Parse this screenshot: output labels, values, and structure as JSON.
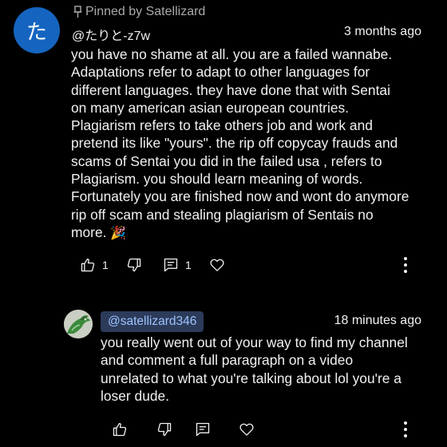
{
  "comment": {
    "avatar_letter": "た",
    "avatar_color": "#1565c0",
    "pinned_label": "Pinned by Satellizard",
    "author": "@たりと-z7w",
    "timestamp": "3 months ago",
    "text": "you have no shame at all. you are a failed wannabe.\nAdaptations refer to adapt to other languages for\ndifferent languages. they have done that with Sentai\non many american asian european countries.\nPlagiarism refers to take others job and work and\npretend its like \"yours\". the rip off copycay frauds and\nscams of Sentai you did in the failed usa , refers to\nPlagiarism. you should learn meaning of words.\nFortunately you are finished now and wont do anymore\nrip off scam and stealing plagiarism of Sentais no\nmore. ",
    "emoji": "🎉",
    "like_count": "1",
    "reply_count": "1",
    "icons": [
      "pin-icon",
      "thumbs-up-icon",
      "thumbs-down-icon",
      "reply-icon",
      "heart-icon",
      "more-vert-icon"
    ]
  },
  "reply": {
    "mention": "@satellizard346",
    "mention_bg": "#2c3b5a",
    "mention_color": "#9ec3ff",
    "timestamp": "18 minutes ago",
    "text": "you really went out of your way to find my channel\nand comment a full paragraph on a video\nunrelated to what you're talking about lol you're a\nloser dude."
  }
}
